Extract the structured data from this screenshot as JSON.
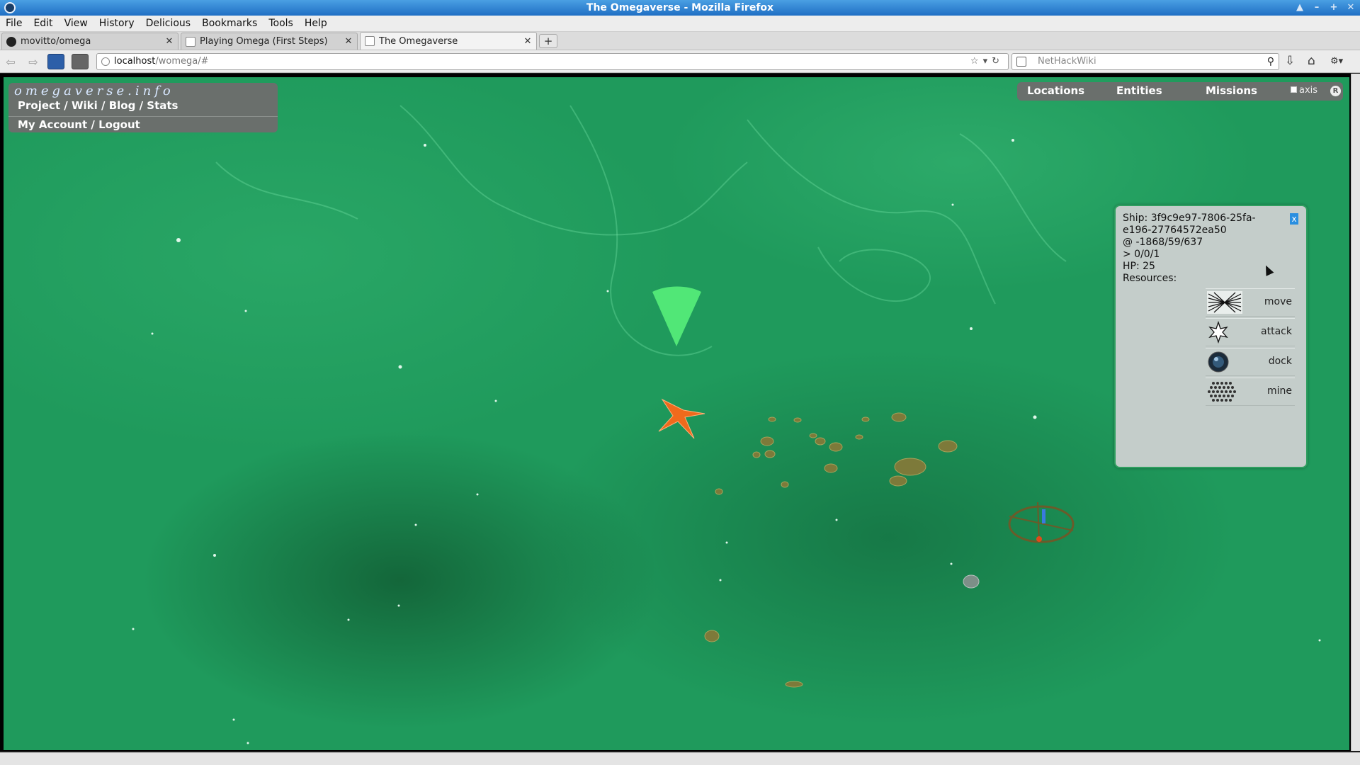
{
  "window": {
    "title": "The Omegaverse - Mozilla Firefox"
  },
  "menu": [
    "File",
    "Edit",
    "View",
    "History",
    "Delicious",
    "Bookmarks",
    "Tools",
    "Help"
  ],
  "tabs": [
    {
      "label": "movitto/omega"
    },
    {
      "label": "Playing Omega (First Steps)"
    },
    {
      "label": "The Omegaverse"
    }
  ],
  "url": {
    "host": "localhost",
    "path": "/womega/#"
  },
  "search": {
    "placeholder": "NetHackWiki"
  },
  "site": {
    "logo": "omegaverse.info",
    "links": "Project / Wiki / Blog / Stats",
    "account": "My Account / Logout"
  },
  "top_nav": {
    "locations": "Locations",
    "entities": "Entities",
    "missions": "Missions",
    "axis": "axis",
    "reset": "R"
  },
  "ship": {
    "line1": "Ship: 3f9c9e97-7806-25fa-",
    "line2": "e196-27764572ea50",
    "location": "@ -1868/59/637",
    "orientation": "> 0/0/1",
    "hp": "HP: 25",
    "resources": "Resources:",
    "close": "x",
    "commands": [
      {
        "label": "move",
        "icon": "move-icon"
      },
      {
        "label": "attack",
        "icon": "attack-icon"
      },
      {
        "label": "dock",
        "icon": "dock-icon"
      },
      {
        "label": "mine",
        "icon": "mine-icon"
      }
    ]
  },
  "colors": {
    "space": "#1f9a5c",
    "panel": "#6a6f6c",
    "dialog": "#c4cdca",
    "titlebar": "#1f6fc4"
  }
}
